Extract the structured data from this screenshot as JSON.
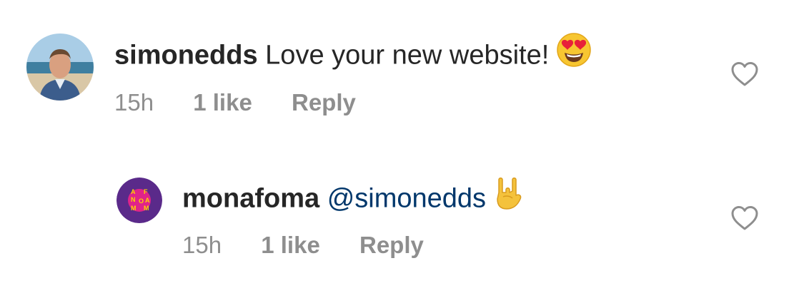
{
  "comments": [
    {
      "username": "simonedds",
      "text": "Love your new website!",
      "emoji": "heart-eyes-emoji",
      "time": "15h",
      "likes": "1 like",
      "reply": "Reply"
    },
    {
      "username": "monafoma",
      "mention": "@simonedds",
      "emoji": "rock-on-hand-emoji",
      "time": "15h",
      "likes": "1 like",
      "reply": "Reply"
    }
  ],
  "icons": {
    "like": "heart-outline-icon"
  },
  "colors": {
    "text": "#262626",
    "secondary": "#8e8e8e",
    "mention": "#00376b",
    "avatar_purple": "#5a2a8a",
    "avatar_pink": "#e0238a",
    "avatar_yellow": "#ffd200"
  }
}
